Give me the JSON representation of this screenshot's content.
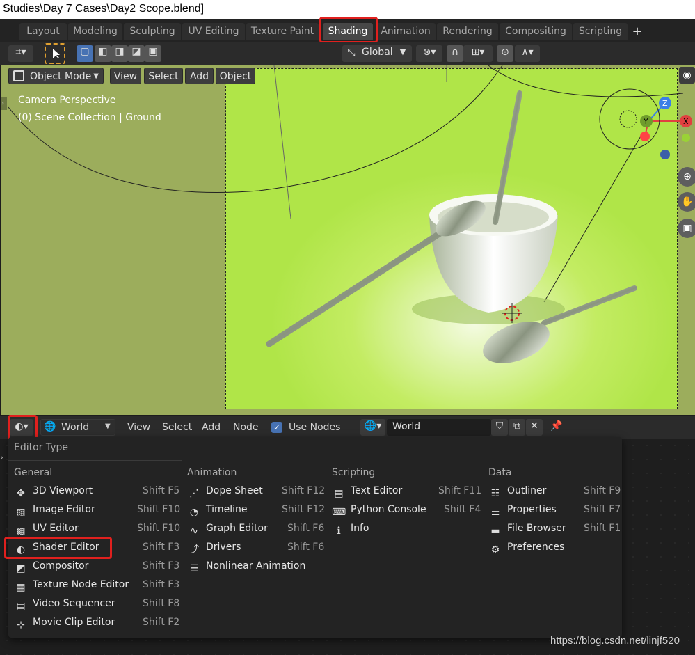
{
  "title": "Studies\\Day 7 Cases\\Day2 Scope.blend]",
  "tabs": [
    "Layout",
    "Modeling",
    "Sculpting",
    "UV Editing",
    "Texture Paint",
    "Shading",
    "Animation",
    "Rendering",
    "Compositing",
    "Scripting"
  ],
  "active_tab": "Shading",
  "add_tab_symbol": "+",
  "header": {
    "orientation": "Global"
  },
  "viewport": {
    "mode": "Object Mode",
    "menus": [
      "View",
      "Select",
      "Add",
      "Object"
    ],
    "overlay_line1": "Camera Perspective",
    "overlay_line2": "(0) Scene Collection | Ground",
    "gizmo": {
      "z": "Z",
      "y": "Y",
      "x": "X"
    }
  },
  "node_header": {
    "world_label": "World",
    "menus": [
      "View",
      "Select",
      "Add",
      "Node"
    ],
    "use_nodes_label": "Use Nodes",
    "use_nodes_checked": true,
    "world_field": "World"
  },
  "menu": {
    "title": "Editor Type",
    "columns": [
      {
        "heading": "General",
        "items": [
          {
            "label": "3D Viewport",
            "shortcut": "Shift F5",
            "icon": "viewport-icon"
          },
          {
            "label": "Image Editor",
            "shortcut": "Shift F10",
            "icon": "image-icon"
          },
          {
            "label": "UV Editor",
            "shortcut": "Shift F10",
            "icon": "uv-icon"
          },
          {
            "label": "Shader Editor",
            "shortcut": "Shift F3",
            "icon": "shader-icon"
          },
          {
            "label": "Compositor",
            "shortcut": "Shift F3",
            "icon": "compositor-icon"
          },
          {
            "label": "Texture Node Editor",
            "shortcut": "Shift F3",
            "icon": "texture-icon"
          },
          {
            "label": "Video Sequencer",
            "shortcut": "Shift F8",
            "icon": "sequencer-icon"
          },
          {
            "label": "Movie Clip Editor",
            "shortcut": "Shift F2",
            "icon": "clip-icon"
          }
        ]
      },
      {
        "heading": "Animation",
        "items": [
          {
            "label": "Dope Sheet",
            "shortcut": "Shift F12",
            "icon": "dopesheet-icon"
          },
          {
            "label": "Timeline",
            "shortcut": "Shift F12",
            "icon": "timeline-icon"
          },
          {
            "label": "Graph Editor",
            "shortcut": "Shift F6",
            "icon": "graph-icon"
          },
          {
            "label": "Drivers",
            "shortcut": "Shift F6",
            "icon": "drivers-icon"
          },
          {
            "label": "Nonlinear Animation",
            "shortcut": "",
            "icon": "nla-icon"
          }
        ]
      },
      {
        "heading": "Scripting",
        "items": [
          {
            "label": "Text Editor",
            "shortcut": "Shift F11",
            "icon": "text-icon"
          },
          {
            "label": "Python Console",
            "shortcut": "Shift F4",
            "icon": "console-icon"
          },
          {
            "label": "Info",
            "shortcut": "",
            "icon": "info-icon"
          }
        ]
      },
      {
        "heading": "Data",
        "items": [
          {
            "label": "Outliner",
            "shortcut": "Shift F9",
            "icon": "outliner-icon"
          },
          {
            "label": "Properties",
            "shortcut": "Shift F7",
            "icon": "properties-icon"
          },
          {
            "label": "File Browser",
            "shortcut": "Shift F1",
            "icon": "filebrowser-icon"
          },
          {
            "label": "Preferences",
            "shortcut": "",
            "icon": "gear-icon"
          }
        ]
      }
    ]
  },
  "watermark": "https://blog.csdn.net/linjf520",
  "colors": {
    "highlight": "#e0201e",
    "accent": "#4772b3",
    "viewport_bg": "#9cad5c"
  }
}
